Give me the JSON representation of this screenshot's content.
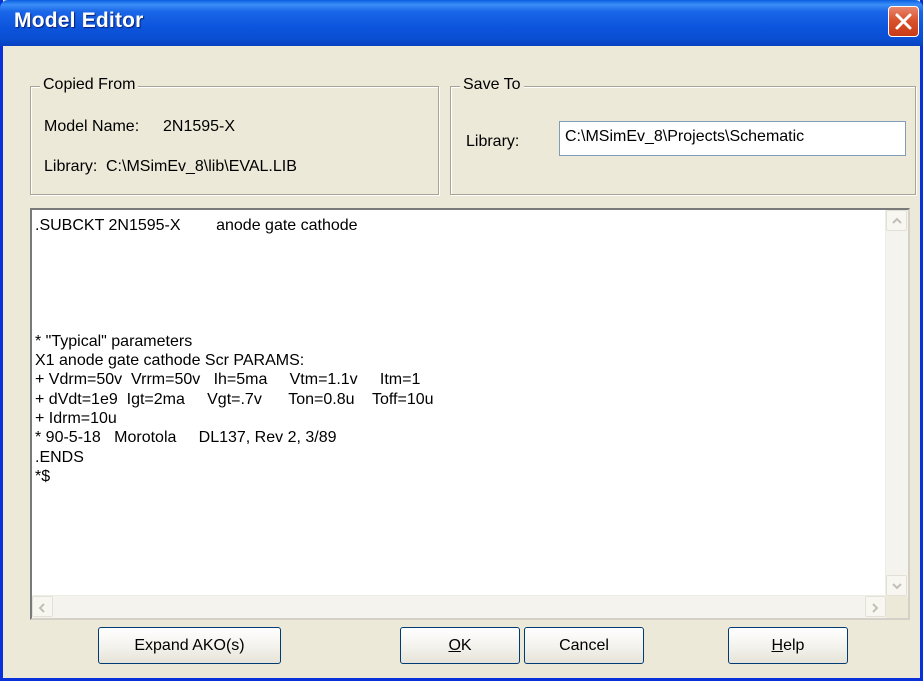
{
  "window": {
    "title": "Model Editor"
  },
  "copied_from": {
    "legend": "Copied From",
    "model_name_label": "Model Name:",
    "model_name_value": "2N1595-X",
    "library_label": "Library:",
    "library_value": "C:\\MSimEv_8\\lib\\EVAL.LIB"
  },
  "save_to": {
    "legend": "Save To",
    "library_label": "Library:",
    "library_value": "C:\\MSimEv_8\\Projects\\Schematic"
  },
  "editor": {
    "text": ".SUBCKT 2N1595-X        anode gate cathode\n\n\n\n\n\n* \"Typical\" parameters\nX1 anode gate cathode Scr PARAMS:\n+ Vdrm=50v  Vrrm=50v   Ih=5ma     Vtm=1.1v     Itm=1\n+ dVdt=1e9  Igt=2ma     Vgt=.7v      Ton=0.8u    Toff=10u\n+ Idrm=10u\n* 90-5-18   Morotola     DL137, Rev 2, 3/89\n.ENDS\n*$"
  },
  "buttons": {
    "expand": "Expand AKO(s)",
    "ok_mnemonic": "O",
    "ok_rest": "K",
    "cancel": "Cancel",
    "help_mnemonic": "H",
    "help_rest": "elp"
  },
  "icons": {
    "close": "close-icon",
    "scroll_up": "scroll-up-arrow-icon",
    "scroll_down": "scroll-down-arrow-icon",
    "scroll_left": "scroll-left-arrow-icon",
    "scroll_right": "scroll-right-arrow-icon"
  },
  "colors": {
    "titlebar": "#0a54dc",
    "window_face": "#ece9d8",
    "close_button": "#d9532d"
  }
}
